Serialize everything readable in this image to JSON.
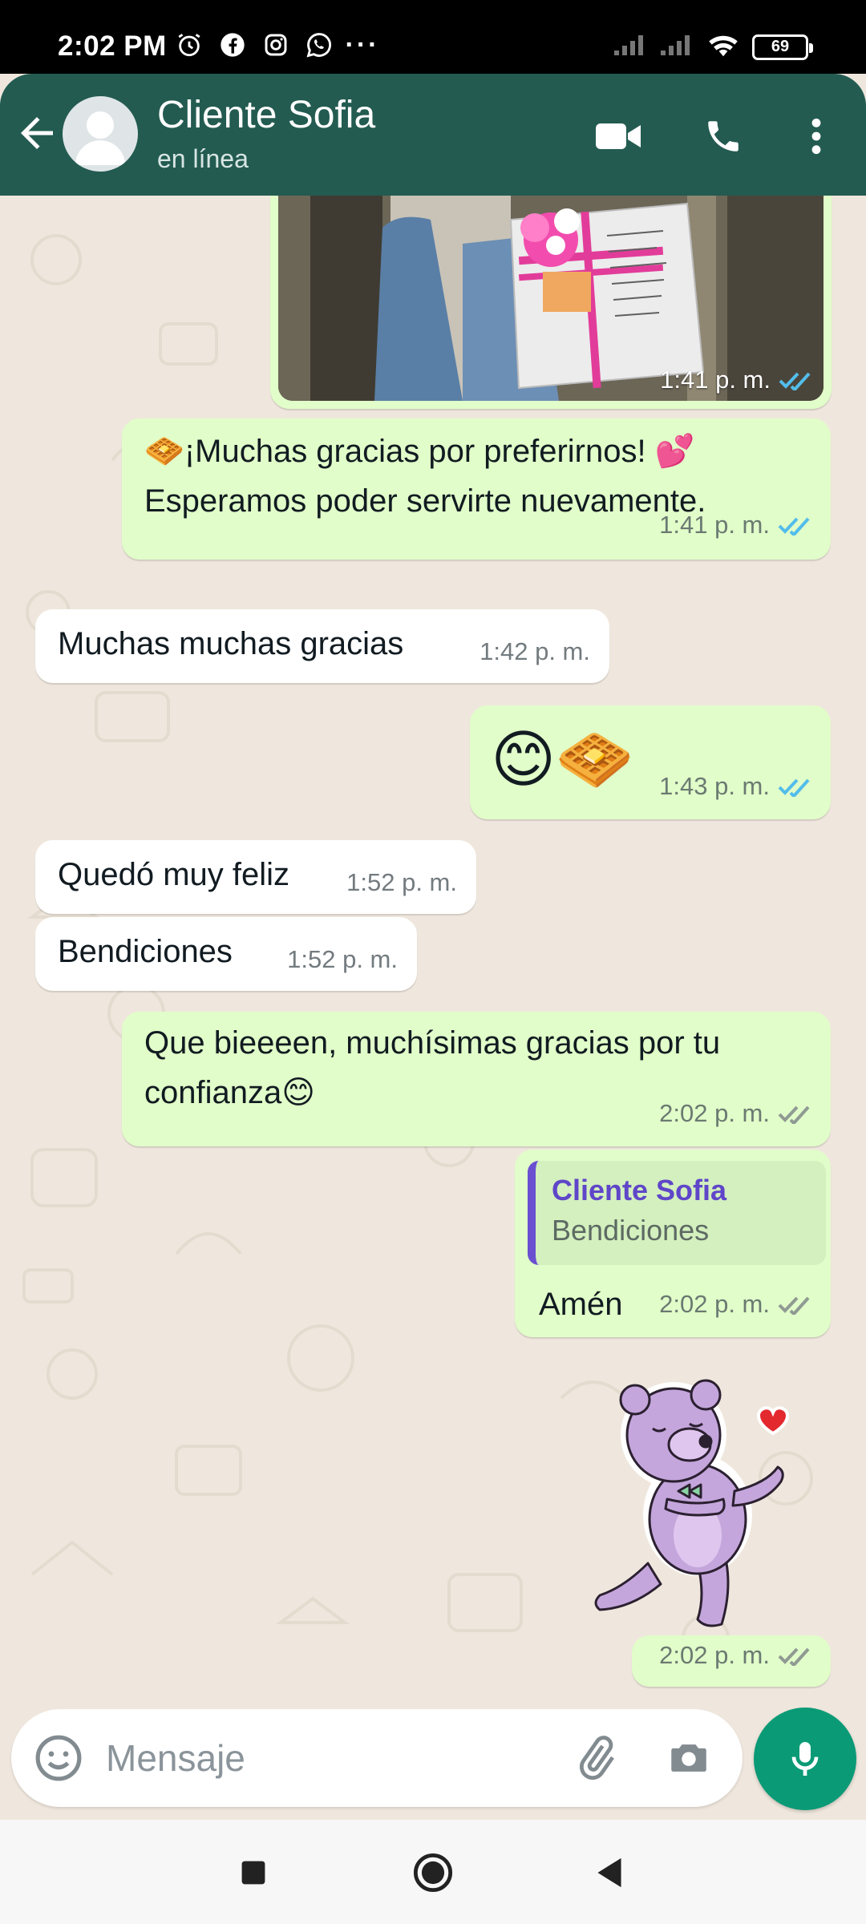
{
  "status_bar": {
    "time": "2:02 PM",
    "icons": [
      "alarm-icon",
      "facebook-icon",
      "instagram-icon",
      "whatsapp-icon",
      "more-dots-icon"
    ],
    "battery": "69"
  },
  "header": {
    "contact_name": "Cliente Sofia",
    "status": "en línea",
    "color": "#235b51"
  },
  "messages": [
    {
      "type": "image",
      "direction": "out",
      "time": "1:41 p. m.",
      "read": true
    },
    {
      "type": "text",
      "direction": "out",
      "line1": "¡Muchas gracias por preferirnos! ",
      "line2": "Esperamos poder servirte nuevamente.",
      "emoji_start": "🧇",
      "emoji_end": "💕",
      "time": "1:41 p. m.",
      "read": true
    },
    {
      "type": "text",
      "direction": "in",
      "text": "Muchas muchas gracias",
      "time": "1:42 p. m."
    },
    {
      "type": "emoji",
      "direction": "out",
      "emojis": "😊🧇",
      "time": "1:43 p. m.",
      "read": true
    },
    {
      "type": "text",
      "direction": "in",
      "text": "Quedó muy feliz",
      "time": "1:52 p. m."
    },
    {
      "type": "text",
      "direction": "in",
      "text": "Bendiciones",
      "time": "1:52 p. m."
    },
    {
      "type": "text",
      "direction": "out",
      "line1": "Que bieeeen, muchísimas gracias por tu",
      "line2": "confianza",
      "emoji_end": "😊",
      "time": "2:02 p. m.",
      "read": false
    },
    {
      "type": "reply",
      "direction": "out",
      "quoted_name": "Cliente Sofia",
      "quoted_text": "Bendiciones",
      "text": "Amén",
      "time": "2:02 p. m.",
      "read": false
    },
    {
      "type": "sticker",
      "direction": "out",
      "sticker": "bear-heart-sticker"
    },
    {
      "type": "time-only",
      "direction": "out",
      "time": "2:02 p. m.",
      "read": false
    }
  ],
  "input": {
    "placeholder": "Mensaje"
  },
  "colors": {
    "outgoing_bubble": "#e1fdc9",
    "incoming_bubble": "#ffffff",
    "read_tick": "#53bdeb",
    "unread_tick": "#8f9a93",
    "mic_button": "#0a9a76",
    "chat_background": "#efe7dd"
  }
}
